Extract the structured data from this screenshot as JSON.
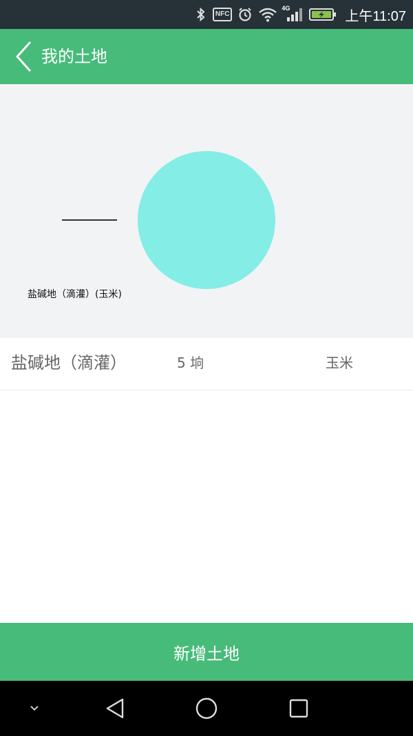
{
  "status_bar": {
    "time": "上午11:07",
    "network": "4G",
    "nfc": "NFC",
    "icons": [
      "bluetooth-icon",
      "nfc-icon",
      "alarm-icon",
      "wifi-icon",
      "signal-icon",
      "battery-charging-icon"
    ]
  },
  "app_bar": {
    "title": "我的土地",
    "back_icon": "chevron-left-icon",
    "color": "#47bb7a"
  },
  "chart_data": {
    "type": "pie",
    "categories": [
      "盐碱地（滴灌）(玉米)"
    ],
    "values": [
      5
    ],
    "colors": [
      "#83ede6"
    ],
    "labels": [
      "盐碱地（滴灌）(玉米)"
    ]
  },
  "lands": [
    {
      "name": "盐碱地（滴灌）",
      "area": "5 垧",
      "crop": "玉米"
    }
  ],
  "actions": {
    "add_land": "新增土地"
  },
  "nav_bar": {
    "icons": [
      "chevron-down-icon",
      "back-triangle-icon",
      "home-circle-icon",
      "recents-square-icon"
    ]
  }
}
